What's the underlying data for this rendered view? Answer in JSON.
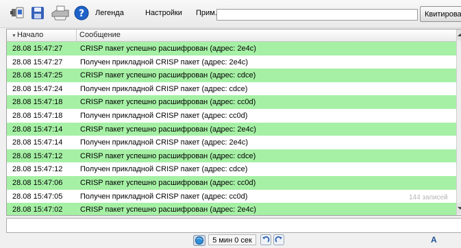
{
  "toolbar": {
    "legend_label": "Легенда",
    "settings_label": "Настройки",
    "note_label": "Прим.",
    "note_value": "",
    "acknowledge_label": "Квитировать"
  },
  "table": {
    "columns": {
      "start": "Начало",
      "message": "Сообщение"
    },
    "rows": [
      {
        "time": "28.08 15:47:27",
        "message": "CRISP пакет успешно расшифрован (адрес: 2e4c)",
        "highlight": true
      },
      {
        "time": "28.08 15:47:27",
        "message": "Получен прикладной CRISP пакет (адрес: 2e4c)",
        "highlight": false
      },
      {
        "time": "28.08 15:47:25",
        "message": "CRISP пакет успешно расшифрован (адрес: cdce)",
        "highlight": true
      },
      {
        "time": "28.08 15:47:24",
        "message": "Получен прикладной CRISP пакет (адрес: cdce)",
        "highlight": false
      },
      {
        "time": "28.08 15:47:18",
        "message": "CRISP пакет успешно расшифрован (адрес: cc0d)",
        "highlight": true
      },
      {
        "time": "28.08 15:47:18",
        "message": "Получен прикладной CRISP пакет (адрес: cc0d)",
        "highlight": false
      },
      {
        "time": "28.08 15:47:14",
        "message": "CRISP пакет успешно расшифрован (адрес: 2e4c)",
        "highlight": true
      },
      {
        "time": "28.08 15:47:14",
        "message": "Получен прикладной CRISP пакет (адрес: 2e4c)",
        "highlight": false
      },
      {
        "time": "28.08 15:47:12",
        "message": "CRISP пакет успешно расшифрован (адрес: cdce)",
        "highlight": true
      },
      {
        "time": "28.08 15:47:12",
        "message": "Получен прикладной CRISP пакет (адрес: cdce)",
        "highlight": false
      },
      {
        "time": "28.08 15:47:06",
        "message": "CRISP пакет успешно расшифрован (адрес: cc0d)",
        "highlight": true
      },
      {
        "time": "28.08 15:47:05",
        "message": "Получен прикладной CRISP пакет (адрес: cc0d)",
        "highlight": false
      },
      {
        "time": "28.08 15:47:02",
        "message": "CRISP пакет успешно расшифрован (адрес: 2e4c)",
        "highlight": true
      }
    ],
    "record_count": "144  записей"
  },
  "statusbar": {
    "interval": "5 мин 0 сек",
    "font_indicator": "A"
  },
  "colors": {
    "row_highlight": "#a5f0a5",
    "row_normal": "#ffffff",
    "help_icon_blue": "#1f63c9",
    "save_icon_blue": "#3560b8"
  },
  "icons": {
    "toolbar": [
      "export-icon",
      "save-icon",
      "print-icon",
      "help-icon"
    ],
    "statusbar": [
      "globe-icon",
      "undo-icon",
      "redo-icon"
    ]
  }
}
